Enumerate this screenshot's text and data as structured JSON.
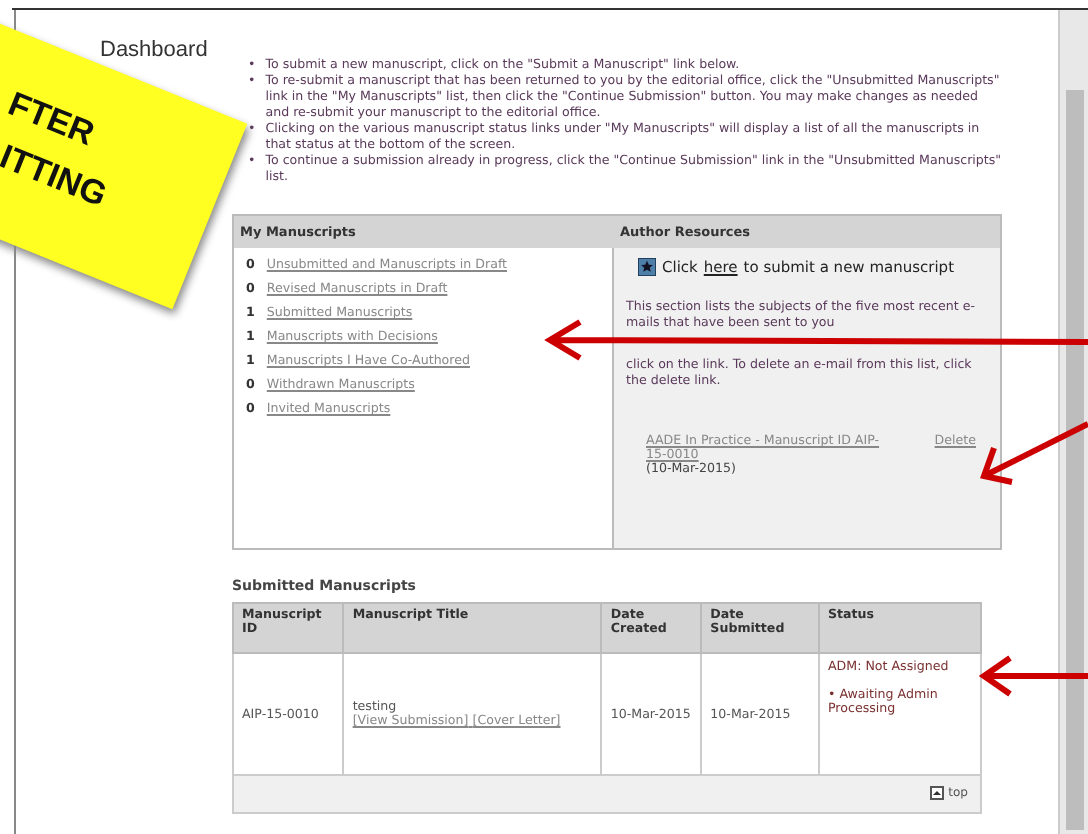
{
  "heading": "Dashboard",
  "bullet": "•",
  "instructions": [
    "To submit a new manuscript, click on the \"Submit a Manuscript\" link below.",
    "To re-submit a manuscript that has been returned to you by the editorial office, click the \"Unsubmitted Manuscripts\" link in the \"My Manuscripts\" list, then click the \"Continue Submission\" button. You may make changes as needed and re-submit your manuscript to the editorial office.",
    "Clicking on the various manuscript status links under \"My Manuscripts\" will display a list of all the manuscripts in that status at the bottom of the screen.",
    "To continue a submission already in progress, click the \"Continue Submission\" link in the \"Unsubmitted Manuscripts\" list."
  ],
  "my_manuscripts": {
    "title": "My Manuscripts",
    "items": [
      {
        "count": "0",
        "label": "Unsubmitted and Manuscripts in Draft"
      },
      {
        "count": "0",
        "label": "Revised Manuscripts in Draft"
      },
      {
        "count": "1",
        "label": "Submitted Manuscripts"
      },
      {
        "count": "1",
        "label": "Manuscripts with Decisions"
      },
      {
        "count": "1",
        "label": "Manuscripts I Have Co-Authored"
      },
      {
        "count": "0",
        "label": "Withdrawn Manuscripts"
      },
      {
        "count": "0",
        "label": "Invited Manuscripts"
      }
    ]
  },
  "author_resources": {
    "title": "Author Resources",
    "submit_before": "Click",
    "submit_link": "here",
    "submit_after": "to submit a new manuscript",
    "info_top": "This section lists the subjects of the five most recent e-mails that have been sent to you",
    "info_bottom": "click on the link. To delete an e-mail from this list, click the delete link.",
    "email": {
      "subject": "AADE In Practice - Manuscript ID AIP-15-0010",
      "date": "(10-Mar-2015)",
      "delete": "Delete"
    }
  },
  "submitted": {
    "title": "Submitted Manuscripts",
    "columns": [
      "Manuscript ID",
      "Manuscript Title",
      "Date Created",
      "Date Submitted",
      "Status"
    ],
    "rows": [
      {
        "id": "AIP-15-0010",
        "title": "testing",
        "links": [
          "[View Submission]",
          "[Cover Letter]"
        ],
        "created": "10-Mar-2015",
        "submitted": "10-Mar-2015",
        "status_top": "ADM: Not Assigned",
        "status": "Awaiting Admin Processing"
      }
    ],
    "top_link": "top"
  },
  "note": {
    "lines": [
      "FTER",
      "ITTING"
    ]
  }
}
